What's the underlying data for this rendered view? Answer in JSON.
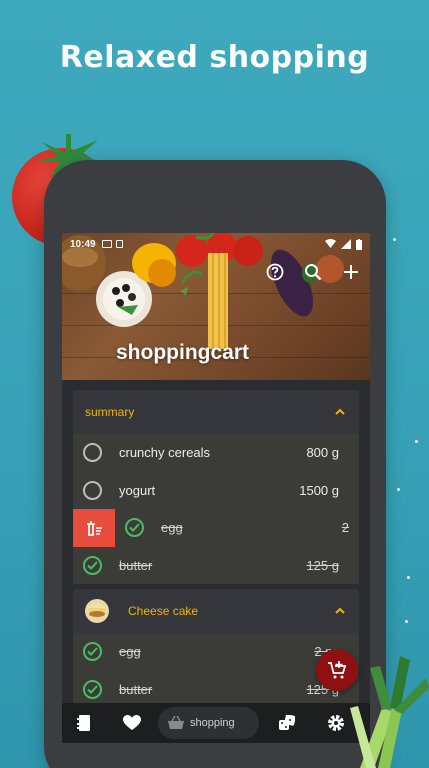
{
  "promo": {
    "headline": "Relaxed shopping"
  },
  "status_bar": {
    "time": "10:49"
  },
  "app_bar": {
    "title": "shoppingcart"
  },
  "summary_card": {
    "title": "summary",
    "items": [
      {
        "name": "crunchy cereals",
        "qty": "800 g",
        "checked": false
      },
      {
        "name": "yogurt",
        "qty": "1500 g",
        "checked": false
      },
      {
        "name": "egg",
        "qty": "2",
        "checked": true
      },
      {
        "name": "butter",
        "qty": "125 g",
        "checked": true
      }
    ]
  },
  "recipe_card": {
    "title": "Cheese cake",
    "items": [
      {
        "name": "egg",
        "qty": "2 pc",
        "checked": true
      },
      {
        "name": "butter",
        "qty": "125 g",
        "checked": true
      }
    ]
  },
  "bottom_nav": {
    "active_label": "shopping"
  },
  "colors": {
    "background": "#3ea9bd",
    "accent": "#f3b400",
    "checked": "#4cbc63",
    "delete": "#e74c3c",
    "fab": "#8e1010"
  },
  "icons": [
    "help-icon",
    "search-icon",
    "add-icon",
    "delete-sweep-icon",
    "check-icon",
    "chevron-up-icon",
    "add-to-cart-icon",
    "notebook-icon",
    "heart-icon",
    "basket-icon",
    "dice-icon",
    "settings-icon"
  ]
}
